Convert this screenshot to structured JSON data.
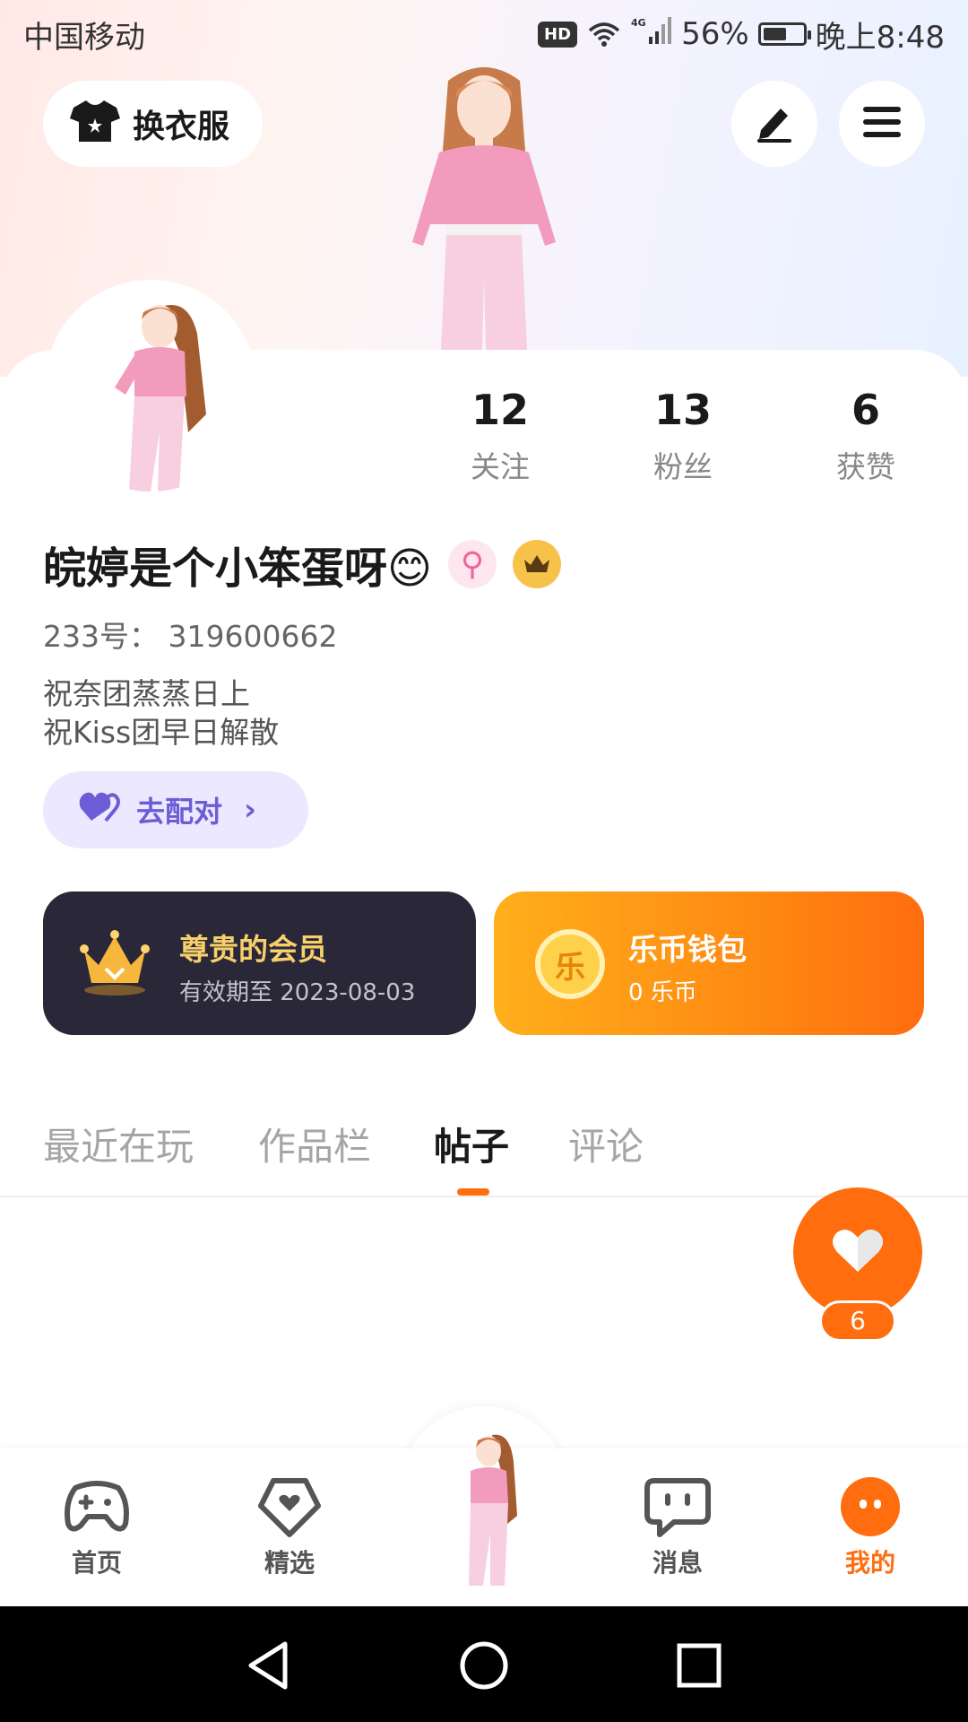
{
  "status_bar": {
    "carrier": "中国移动",
    "hd": "HD",
    "network": "4G",
    "battery": "56%",
    "time": "晚上8:48"
  },
  "header": {
    "outfit_label": "换衣服",
    "edit_icon": "pen-icon",
    "menu_icon": "hamburger-menu-icon"
  },
  "profile": {
    "stats": [
      {
        "value": "12",
        "label": "关注"
      },
      {
        "value": "13",
        "label": "粉丝"
      },
      {
        "value": "6",
        "label": "获赞"
      }
    ],
    "nickname": "皖婷是个小笨蛋呀😊",
    "gender_symbol": "⚲",
    "uid": "233号： 319600662",
    "bio": [
      "祝奈团蒸蒸日上",
      "祝Kiss团早日解散"
    ],
    "match_label": "去配对"
  },
  "vip_card": {
    "title": "尊贵的会员",
    "subtitle": "有效期至 2023-08-03"
  },
  "wallet_card": {
    "coin_char": "乐",
    "title": "乐币钱包",
    "subtitle": "0 乐币"
  },
  "tabs": [
    {
      "label": "最近在玩",
      "active": false
    },
    {
      "label": "作品栏",
      "active": false
    },
    {
      "label": "帖子",
      "active": true
    },
    {
      "label": "评论",
      "active": false
    }
  ],
  "like_fab": {
    "count": "6"
  },
  "bottom_nav": [
    {
      "label": "首页",
      "icon": "gamepad-icon",
      "active": false
    },
    {
      "label": "精选",
      "icon": "heart-shield-icon",
      "active": false
    },
    {
      "label": "消息",
      "icon": "chat-bubble-icon",
      "active": false
    },
    {
      "label": "我的",
      "icon": "profile-face-icon",
      "active": true
    }
  ],
  "colors": {
    "accent": "#ff6d0f",
    "vip_dark": "#2a2838",
    "vip_gold": "#f7cf6b",
    "match_purple": "#6c5cd6"
  }
}
